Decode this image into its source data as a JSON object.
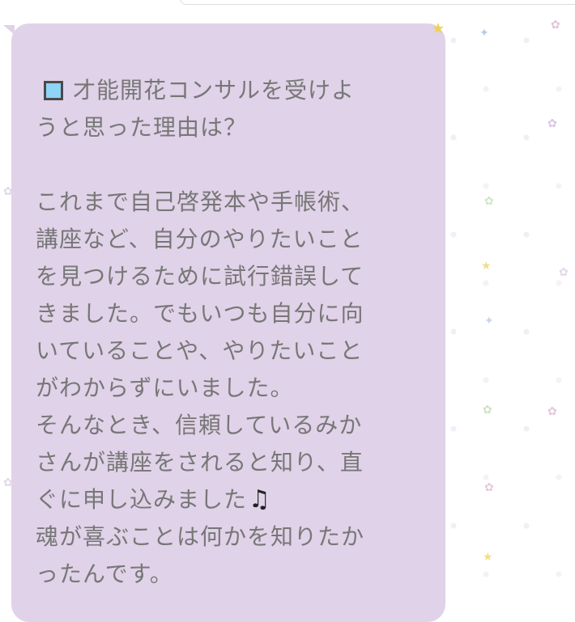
{
  "message": {
    "line1": "才能開花コンサルを受けよ",
    "line2": "うと思った理由は？",
    "line3": "これまで自己啓発本や手帳術、",
    "line4": "講座など、自分のやりたいこと",
    "line5": "を見つけるために試行錯誤して",
    "line6": "きました。でもいつも自分に向",
    "line7": "いていることや、やりたいこと",
    "line8": "がわからずにいました。",
    "line9": "そんなとき、信頼しているみか",
    "line10": "さんが講座をされると知り、直",
    "line11": "ぐに申し込みました",
    "line12": "魂が喜ぶことは何かを知りたか",
    "line13": "ったんです。",
    "icons": {
      "checkbox": "blue-square-icon",
      "music": "music-notes-icon"
    }
  },
  "colors": {
    "bubble_bg": "#e0d2e8",
    "text": "#777777",
    "icon_square": "#8fd3f6"
  }
}
